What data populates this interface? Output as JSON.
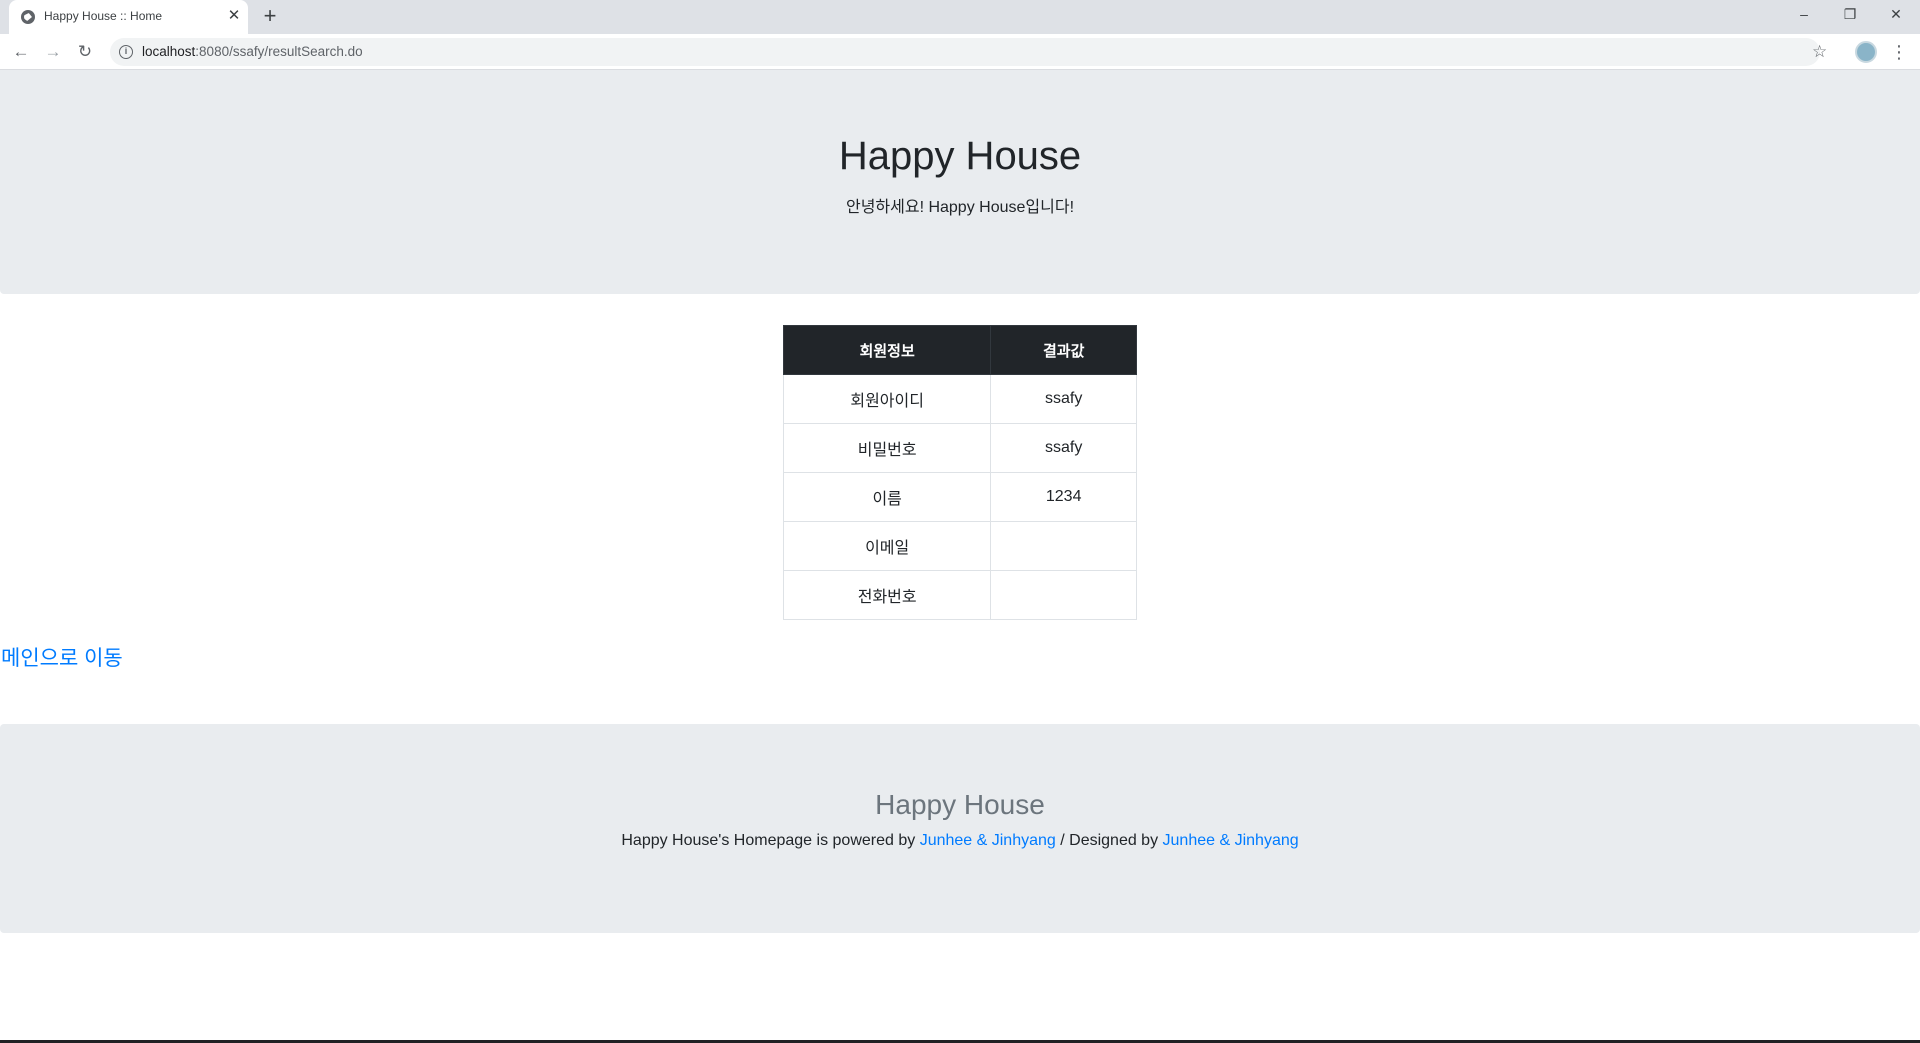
{
  "browser": {
    "tab_title": "Happy House :: Home",
    "tab_close": "✕",
    "new_tab": "+",
    "url_host": "localhost",
    "url_path": ":8080/ssafy/resultSearch.do",
    "window_controls": {
      "minimize": "–",
      "restore": "❐",
      "close": "✕"
    },
    "nav": {
      "back": "←",
      "forward": "→",
      "reload": "↻"
    },
    "star": "☆",
    "menu": "⋮"
  },
  "header": {
    "title": "Happy House",
    "subtitle": "안녕하세요! Happy House입니다!"
  },
  "table": {
    "headers": [
      "회원정보",
      "결과값"
    ],
    "rows": [
      [
        "회원아이디",
        "ssafy"
      ],
      [
        "비밀번호",
        "ssafy"
      ],
      [
        "이름",
        "1234"
      ],
      [
        "이메일",
        ""
      ],
      [
        "전화번호",
        ""
      ]
    ]
  },
  "main_link": "메인으로 이동",
  "footer": {
    "title": "Happy House",
    "text_before": "Happy House's Homepage is powered by ",
    "link1": "Junhee & Jinhyang",
    "text_middle": " / Designed by ",
    "link2": "Junhee & Jinhyang"
  },
  "colors": {
    "jumbotron_bg": "#e9ecef",
    "table_header_bg": "#212529",
    "link": "#007bff",
    "footer_title": "#6c757d"
  }
}
